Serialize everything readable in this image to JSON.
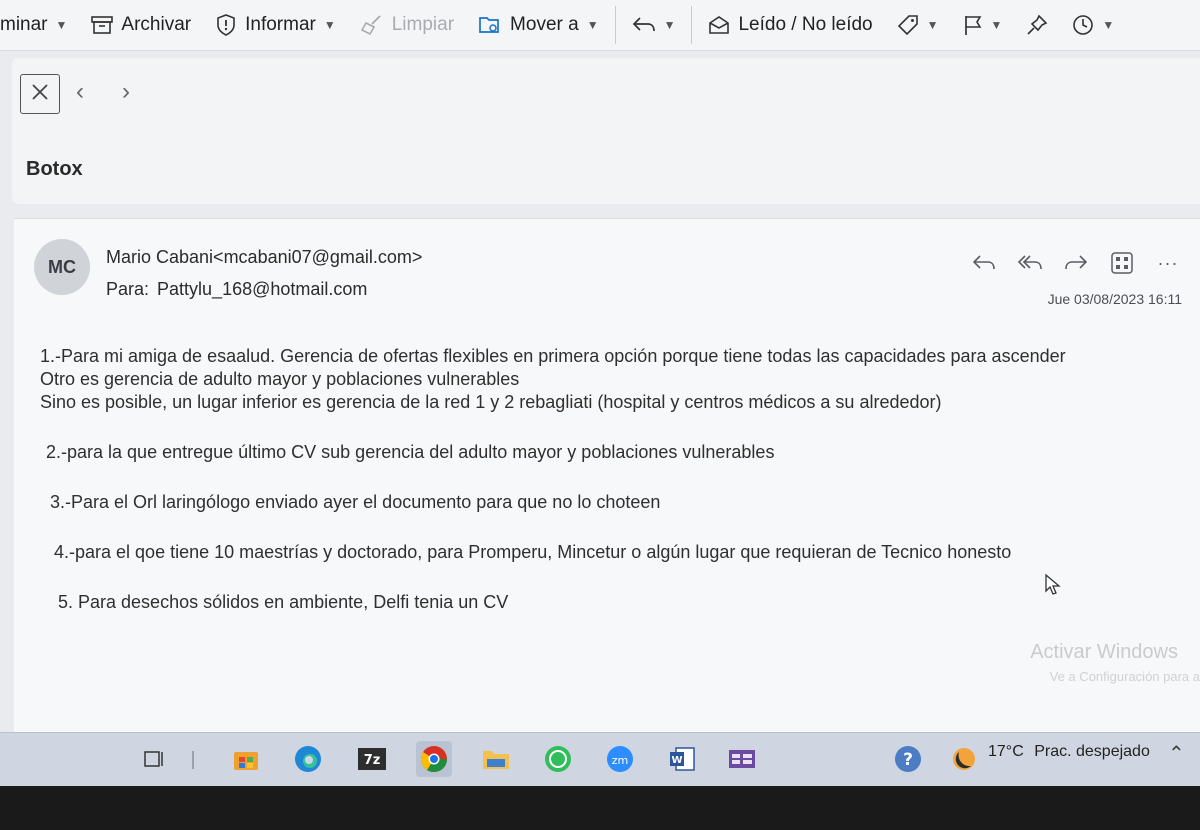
{
  "toolbar": {
    "items": [
      {
        "label": "minar",
        "has_chevron": true
      },
      {
        "label": "Archivar"
      },
      {
        "label": "Informar",
        "has_chevron": true
      },
      {
        "label": "Limpiar",
        "disabled": true
      },
      {
        "label": "Mover a",
        "has_chevron": true
      },
      {
        "label": "Leído / No leído"
      }
    ]
  },
  "subject": "Botox",
  "message": {
    "avatar_initials": "MC",
    "sender": "Mario Cabani<mcabani07@gmail.com>",
    "to_label": "Para:",
    "to": "Pattylu_168@hotmail.com",
    "date": "Jue 03/08/2023 16:11",
    "lines": [
      "1.-Para mi amiga de esaalud.  Gerencia de ofertas flexibles  en primera opción porque tiene todas las capacidades para ascender",
      "Otro es gerencia de adulto mayor y poblaciones vulnerables",
      "Sino es posible, un lugar inferior es gerencia de la red 1 y 2 rebagliati (hospital y centros médicos a su alrededor)",
      "2.-para la que entregue último CV sub gerencia del adulto mayor y poblaciones vulnerables",
      "3.-Para el Orl laringólogo enviado ayer el documento para que no lo choteen",
      "4.-para el qoe tiene 10 maestrías y doctorado, para Promperu,  Mincetur o algún lugar que requieran de Tecnico honesto",
      "5. Para desechos sólidos en ambiente, Delfi tenia un CV"
    ]
  },
  "watermark": {
    "title": "Activar Windows",
    "subtitle": "Ve a Configuración para a"
  },
  "taskbar": {
    "weather_temp": "17°C",
    "weather_text": "Prac. despejado",
    "apps": [
      "task-view",
      "microsoft-store",
      "edge",
      "7zip",
      "chrome",
      "file-explorer",
      "whatsapp",
      "zoom",
      "word",
      "app-grid"
    ]
  },
  "colors": {
    "accent": "#1a73c8",
    "toolbar_bg": "#f4f5f7",
    "taskbar_bg": "#cfd6e2"
  }
}
